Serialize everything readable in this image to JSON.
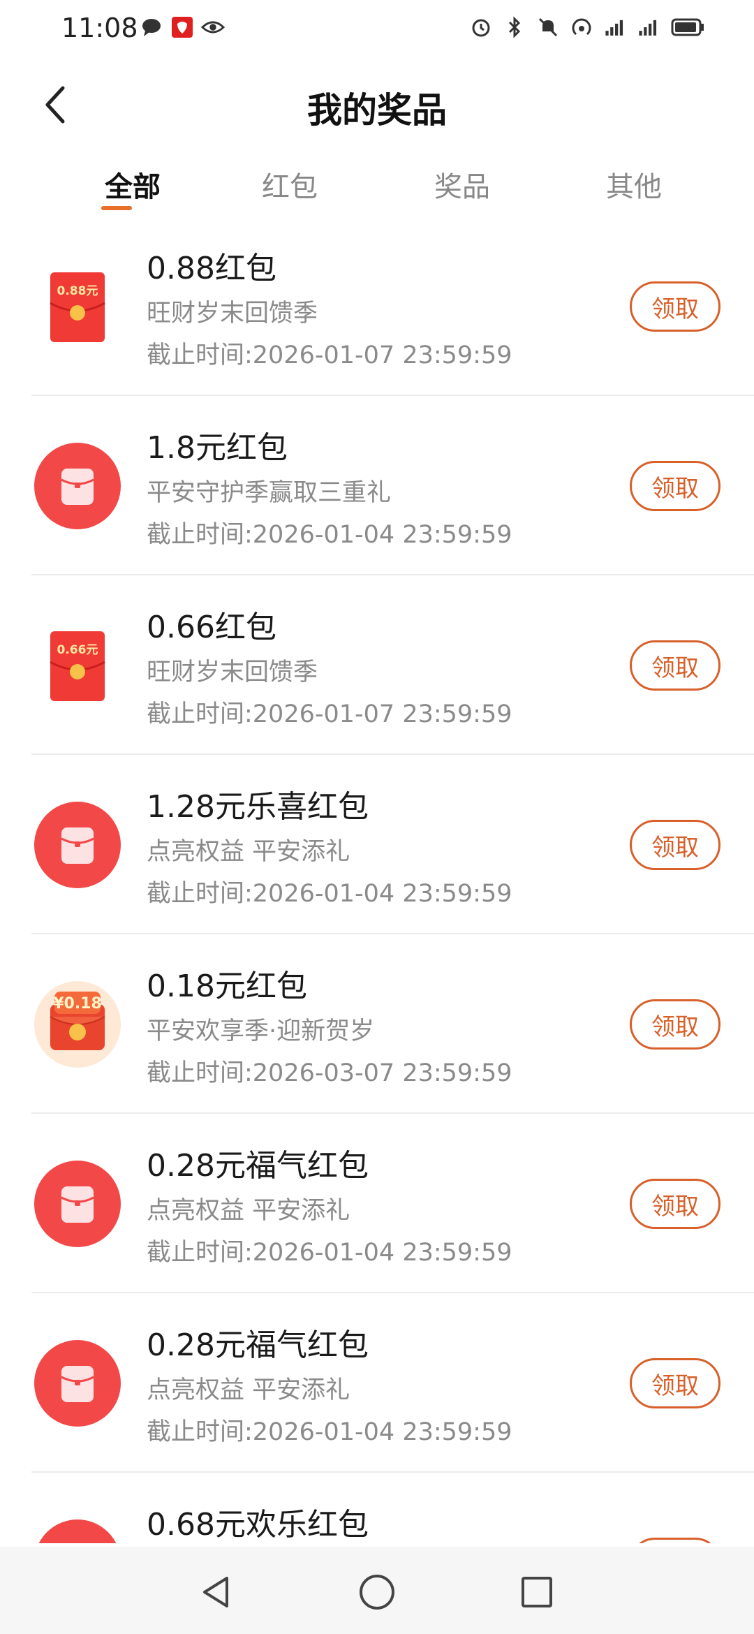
{
  "status_bar": {
    "time": "11:08"
  },
  "header": {
    "title": "我的奖品"
  },
  "tabs": [
    {
      "label": "全部",
      "active": true
    },
    {
      "label": "红包",
      "active": false
    },
    {
      "label": "奖品",
      "active": false
    },
    {
      "label": "其他",
      "active": false
    }
  ],
  "items": [
    {
      "title": "0.88红包",
      "subtitle": "旺财岁末回馈季",
      "deadline": "截止时间:2026-01-07 23:59:59",
      "button": "领取",
      "icon": "red-envelope-amount",
      "icon_text": "0.88元"
    },
    {
      "title": "1.8元红包",
      "subtitle": "平安守护季赢取三重礼",
      "deadline": "截止时间:2026-01-04 23:59:59",
      "button": "领取",
      "icon": "red-envelope-circle"
    },
    {
      "title": "0.66红包",
      "subtitle": "旺财岁末回馈季",
      "deadline": "截止时间:2026-01-07 23:59:59",
      "button": "领取",
      "icon": "red-envelope-amount",
      "icon_text": "0.66元"
    },
    {
      "title": "1.28元乐喜红包",
      "subtitle": "点亮权益 平安添礼",
      "deadline": "截止时间:2026-01-04 23:59:59",
      "button": "领取",
      "icon": "red-envelope-circle"
    },
    {
      "title": "0.18元红包",
      "subtitle": "平安欢享季·迎新贺岁",
      "deadline": "截止时间:2026-03-07 23:59:59",
      "button": "领取",
      "icon": "red-envelope-gold",
      "icon_text": "¥0.18"
    },
    {
      "title": "0.28元福气红包",
      "subtitle": "点亮权益 平安添礼",
      "deadline": "截止时间:2026-01-04 23:59:59",
      "button": "领取",
      "icon": "red-envelope-circle"
    },
    {
      "title": "0.28元福气红包",
      "subtitle": "点亮权益 平安添礼",
      "deadline": "截止时间:2026-01-04 23:59:59",
      "button": "领取",
      "icon": "red-envelope-circle"
    },
    {
      "title": "0.68元欢乐红包",
      "subtitle": "",
      "deadline": "",
      "button": "领取",
      "icon": "red-envelope-circle"
    }
  ],
  "colors": {
    "accent": "#e8702a",
    "button": "#d8602a",
    "envelope": "#f24848"
  }
}
